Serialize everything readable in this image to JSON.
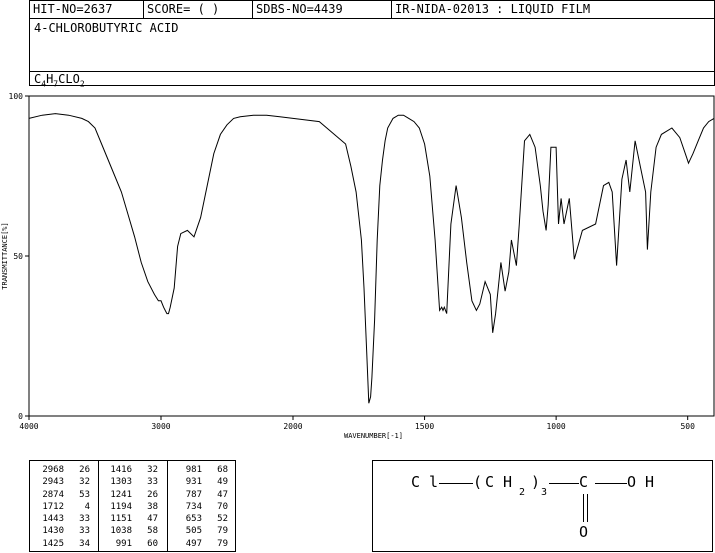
{
  "header": {
    "hit_no": "HIT-NO=2637",
    "score": "SCORE=  (  )",
    "sdbs_no": "SDBS-NO=4439",
    "ir_nida": "IR-NIDA-02013 : LIQUID FILM",
    "compound_name": "4-CHLOROBUTYRIC ACID",
    "formula_parts": [
      "C",
      "4",
      "H",
      "7",
      "CLO",
      "2"
    ]
  },
  "chart_data": {
    "type": "line",
    "title": "",
    "xlabel": "WAVENUMBER[-1]",
    "ylabel": "TRANSMITTANCE[%]",
    "xlim": [
      4000,
      400
    ],
    "ylim": [
      0,
      100
    ],
    "x_ticks": [
      4000,
      3000,
      2000,
      1500,
      1000,
      500
    ],
    "x_tick_labels": [
      "4000",
      "3000",
      "2000",
      "1500",
      "1000",
      "500"
    ],
    "y_ticks": [
      0,
      50,
      100
    ],
    "y_tick_labels": [
      "0",
      "50",
      "100"
    ],
    "series": [
      {
        "x": [
          4000,
          3900,
          3800,
          3700,
          3600,
          3550,
          3500,
          3450,
          3400,
          3350,
          3300,
          3250,
          3200,
          3150,
          3100,
          3050,
          3020,
          3000,
          2980,
          2968,
          2955,
          2943,
          2930,
          2900,
          2874,
          2850,
          2800,
          2750,
          2700,
          2650,
          2600,
          2550,
          2500,
          2450,
          2400,
          2300,
          2200,
          2100,
          2000,
          1900,
          1800,
          1780,
          1760,
          1740,
          1730,
          1720,
          1712,
          1705,
          1700,
          1690,
          1680,
          1670,
          1660,
          1650,
          1640,
          1620,
          1600,
          1580,
          1560,
          1540,
          1520,
          1500,
          1480,
          1460,
          1443,
          1435,
          1430,
          1425,
          1416,
          1400,
          1380,
          1360,
          1340,
          1320,
          1303,
          1290,
          1270,
          1250,
          1241,
          1230,
          1210,
          1194,
          1180,
          1170,
          1151,
          1140,
          1120,
          1100,
          1080,
          1060,
          1050,
          1038,
          1030,
          1020,
          1000,
          991,
          981,
          970,
          950,
          931,
          900,
          850,
          820,
          800,
          787,
          770,
          750,
          734,
          720,
          700,
          680,
          660,
          653,
          640,
          620,
          600,
          560,
          530,
          505,
          497,
          480,
          460,
          440,
          420,
          400
        ],
        "y": [
          93,
          94,
          94.5,
          94,
          93,
          92,
          90,
          85,
          80,
          75,
          70,
          63,
          56,
          48,
          42,
          38,
          36,
          36,
          34,
          33,
          32,
          32,
          34,
          40,
          53,
          57,
          58,
          56,
          62,
          72,
          82,
          88,
          91,
          93,
          93.5,
          94,
          94,
          93.5,
          93,
          92,
          85,
          78,
          70,
          55,
          40,
          20,
          4,
          6,
          12,
          30,
          55,
          72,
          80,
          86,
          90,
          93,
          94,
          94,
          93,
          92,
          90,
          85,
          75,
          55,
          33,
          34,
          33,
          34,
          32,
          60,
          72,
          62,
          48,
          36,
          33,
          35,
          42,
          38,
          26,
          32,
          48,
          39,
          45,
          55,
          47,
          60,
          86,
          88,
          84,
          72,
          64,
          58,
          66,
          84,
          84,
          60,
          68,
          60,
          68,
          49,
          58,
          60,
          72,
          73,
          70,
          47,
          74,
          80,
          70,
          86,
          78,
          70,
          52,
          70,
          84,
          88,
          90,
          87,
          81,
          79,
          82,
          86,
          90,
          92,
          93
        ]
      }
    ],
    "peak_table": [
      [
        [
          "2968",
          "26"
        ],
        [
          "2943",
          "32"
        ],
        [
          "2874",
          "53"
        ],
        [
          "1712",
          "4"
        ],
        [
          "1443",
          "33"
        ],
        [
          "1430",
          "33"
        ],
        [
          "1425",
          "34"
        ]
      ],
      [
        [
          "1416",
          "32"
        ],
        [
          "1303",
          "33"
        ],
        [
          "1241",
          "26"
        ],
        [
          "1194",
          "38"
        ],
        [
          "1151",
          "47"
        ],
        [
          "1038",
          "58"
        ],
        [
          "991",
          "60"
        ]
      ],
      [
        [
          "981",
          "68"
        ],
        [
          "931",
          "49"
        ],
        [
          "787",
          "47"
        ],
        [
          "734",
          "70"
        ],
        [
          "653",
          "52"
        ],
        [
          "505",
          "79"
        ],
        [
          "497",
          "79"
        ]
      ]
    ]
  },
  "structure": {
    "cl": "C l",
    "open_paren": "(",
    "ch": "C H",
    "sub_2": "2",
    "close_paren": ")",
    "sub_3": "3",
    "carbon": "C",
    "oh": "O H",
    "oxygen": "O"
  }
}
